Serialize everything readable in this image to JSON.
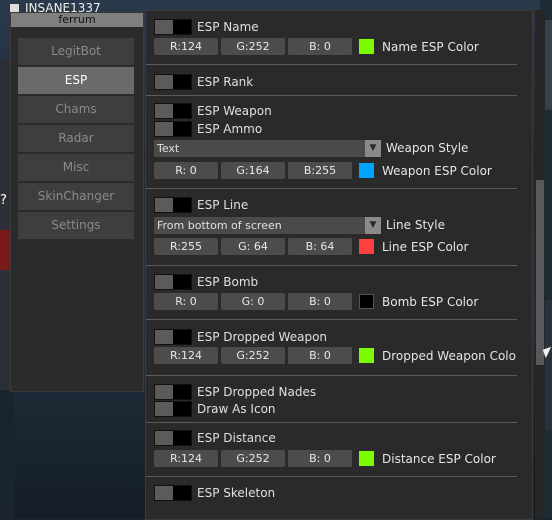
{
  "hud": {
    "player_name": "INSANE1337",
    "question_mark": "?"
  },
  "left_panel": {
    "title": "ferrum",
    "items": [
      {
        "label": "LegitBot",
        "active": false
      },
      {
        "label": "ESP",
        "active": true
      },
      {
        "label": "Chams",
        "active": false
      },
      {
        "label": "Radar",
        "active": false
      },
      {
        "label": "Misc",
        "active": false
      },
      {
        "label": "SkinChanger",
        "active": false
      },
      {
        "label": "Settings",
        "active": false
      }
    ]
  },
  "esp": {
    "name": {
      "label": "ESP Name",
      "r": "R:124",
      "g": "G:252",
      "b": "B:  0",
      "color": "#7cfc00",
      "color_label": "Name ESP Color"
    },
    "rank": {
      "label": "ESP Rank"
    },
    "weapon": {
      "label": "ESP Weapon"
    },
    "ammo": {
      "label": "ESP Ammo"
    },
    "weapon_style": {
      "value": "Text",
      "label": "Weapon Style"
    },
    "weapon_color": {
      "r": "R:  0",
      "g": "G:164",
      "b": "B:255",
      "color": "#00a4ff",
      "color_label": "Weapon ESP Color"
    },
    "line": {
      "label": "ESP Line"
    },
    "line_style": {
      "value": "From bottom of screen",
      "label": "Line Style"
    },
    "line_color": {
      "r": "R:255",
      "g": "G: 64",
      "b": "B: 64",
      "color": "#ff4040",
      "color_label": "Line ESP Color"
    },
    "bomb": {
      "label": "ESP Bomb",
      "r": "R:  0",
      "g": "G:  0",
      "b": "B:  0",
      "color": "#000000",
      "color_label": "Bomb ESP Color"
    },
    "dropped_weapon": {
      "label": "ESP Dropped Weapon",
      "r": "R:124",
      "g": "G:252",
      "b": "B:  0",
      "color": "#7cfc00",
      "color_label": "Dropped Weapon Colo"
    },
    "dropped_nades": {
      "label": "ESP Dropped Nades"
    },
    "draw_as_icon": {
      "label": "Draw As Icon"
    },
    "distance": {
      "label": "ESP Distance",
      "r": "R:124",
      "g": "G:252",
      "b": "B:  0",
      "color": "#7cfc00",
      "color_label": "Distance ESP Color"
    },
    "skeleton": {
      "label": "ESP Skeleton"
    }
  }
}
